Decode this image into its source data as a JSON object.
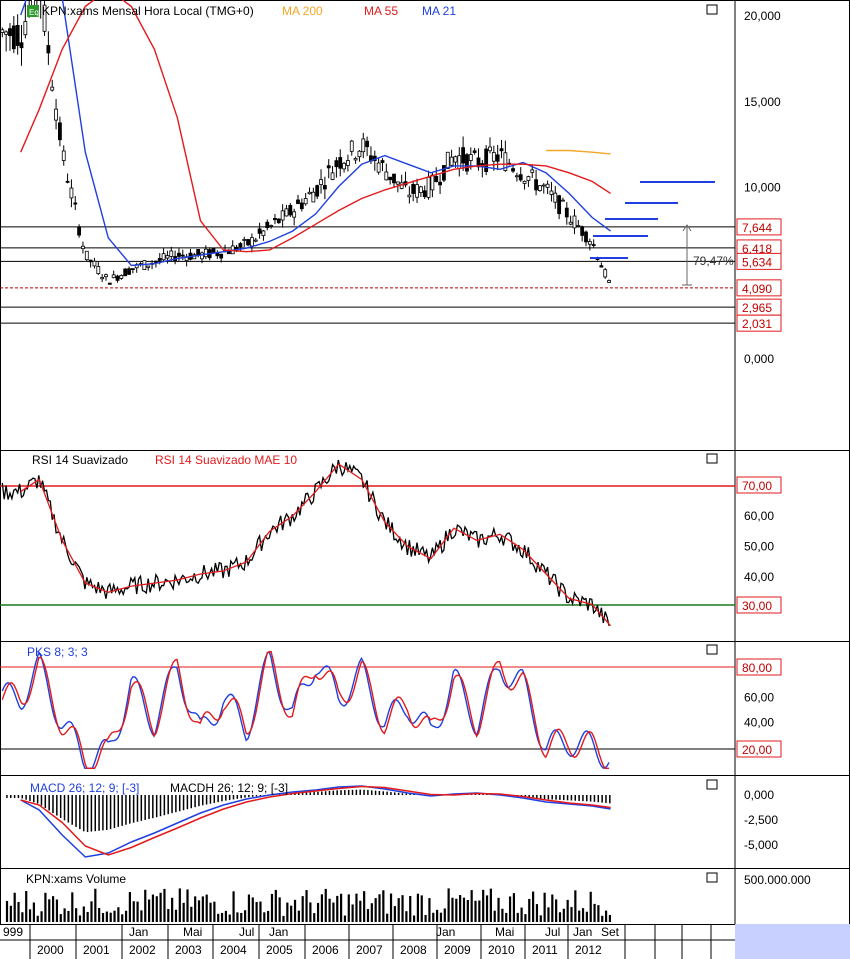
{
  "colors": {
    "black": "#000000",
    "red": "#e31a1c",
    "blue": "#1f3fe0",
    "orange": "#f5a623",
    "green": "#1a7a1a",
    "grid": "#000000"
  },
  "main_panel": {
    "badge": "Eq",
    "title": "KPN:xams Mensal Hora Local (TMG+0)",
    "ma200_label": "MA 200",
    "ma55_label": "MA 55",
    "ma21_label": "MA 21",
    "y_ticks": [
      "20,000",
      "15,000",
      "10,000",
      "0,000"
    ],
    "level_labels": [
      "7,644",
      "6,418",
      "5,634",
      "4,090",
      "2,965",
      "2,031"
    ],
    "pct_label": "79,47%"
  },
  "rsi_panel": {
    "title": "RSI 14 Suavizado",
    "sub": "RSI 14 Suavizado MAE 10",
    "y_ticks": [
      "60,00",
      "50,00",
      "40,00"
    ],
    "hi_label": "70,00",
    "lo_label": "30,00"
  },
  "pks_panel": {
    "title": "PKS 8; 3; 3",
    "y_ticks": [
      "60,00",
      "40,00"
    ],
    "hi_label": "80,00",
    "lo_label": "20,00"
  },
  "macd_panel": {
    "title": "MACD 26; 12; 9; [-3]",
    "sub": "MACDH 26; 12; 9; [-3]",
    "y_ticks": [
      "0,000",
      "-2,500",
      "-5,000"
    ]
  },
  "vol_panel": {
    "title": "KPN:xams Volume",
    "y_ticks": [
      "500.000.000"
    ]
  },
  "x_axis": {
    "months": [
      "999",
      "Jan",
      "Mai",
      "Jul",
      "Jan",
      "Jan",
      "Jan",
      "Mai",
      "Jul",
      "Jan",
      "Set"
    ],
    "years": [
      "2000",
      "2001",
      "2002",
      "2003",
      "2004",
      "2005",
      "2006",
      "2007",
      "2008",
      "2009",
      "2010",
      "2011",
      "2012"
    ]
  },
  "chart_data": {
    "type": "line",
    "title": "KPN:xams Mensal Hora Local (TMG+0)",
    "x": [
      1999.9,
      2000.3,
      2000.8,
      2001.3,
      2001.8,
      2002.3,
      2002.8,
      2003.3,
      2003.8,
      2004.3,
      2004.8,
      2005.3,
      2005.8,
      2006.3,
      2006.8,
      2007.3,
      2007.8,
      2008.3,
      2008.8,
      2009.3,
      2009.8,
      2010.3,
      2010.8,
      2011.3,
      2011.8,
      2012.3,
      2012.7
    ],
    "series": [
      {
        "name": "KPN:xams",
        "values": [
          19,
          22,
          12,
          6,
          4.5,
          5.2,
          5.6,
          6.0,
          6.0,
          6.2,
          6.6,
          7.6,
          8.6,
          9.8,
          11.5,
          12.4,
          11.0,
          9.6,
          10.0,
          11.8,
          11.4,
          11.8,
          10.8,
          9.8,
          8.3,
          6.8,
          4.1
        ]
      },
      {
        "name": "MA 21",
        "values": [
          20,
          23,
          21,
          12,
          7,
          5.4,
          5.5,
          5.8,
          6.0,
          6.2,
          6.4,
          6.8,
          7.4,
          8.4,
          10,
          11.3,
          11.8,
          11.3,
          10.8,
          11.2,
          11.2,
          11.0,
          11.4,
          10.8,
          9.6,
          8.2,
          7.4
        ]
      },
      {
        "name": "MA 55",
        "values": [
          12,
          14.5,
          18,
          20.5,
          21.5,
          20.5,
          18,
          14,
          8,
          6.3,
          6.2,
          6.3,
          7.0,
          7.8,
          8.6,
          9.3,
          9.8,
          10.2,
          10.6,
          11.0,
          11.2,
          11.3,
          11.3,
          11.2,
          10.8,
          10.3,
          9.6
        ]
      },
      {
        "name": "MA 200",
        "values": [
          null,
          null,
          null,
          null,
          null,
          null,
          null,
          null,
          null,
          null,
          null,
          null,
          null,
          null,
          null,
          null,
          null,
          null,
          null,
          null,
          null,
          null,
          null,
          12.1,
          12.1,
          12.0,
          11.9
        ]
      }
    ],
    "levels": [
      7.644,
      6.418,
      5.634,
      4.09,
      2.965,
      2.031
    ],
    "ylim": [
      0,
      21
    ],
    "rsi": {
      "ylim": [
        20,
        80
      ],
      "values": [
        68,
        72,
        52,
        38,
        35,
        37,
        38,
        39,
        41,
        42,
        45,
        55,
        60,
        68,
        77,
        72,
        58,
        50,
        46,
        56,
        52,
        54,
        49,
        41,
        33,
        31,
        24
      ]
    },
    "pks": {
      "ylim": [
        0,
        100
      ],
      "values": [
        60,
        85,
        40,
        10,
        15,
        70,
        40,
        85,
        30,
        60,
        35,
        90,
        45,
        90,
        60,
        80,
        40,
        55,
        30,
        75,
        40,
        85,
        70,
        20,
        25,
        20,
        12
      ]
    },
    "macd": {
      "ylim": [
        -6.5,
        1
      ],
      "values": [
        -0.5,
        -1.5,
        -4,
        -6.2,
        -5.8,
        -4.7,
        -3.8,
        -2.8,
        -1.8,
        -1,
        -0.4,
        0,
        0.3,
        0.5,
        0.8,
        0.9,
        0.6,
        0.2,
        -0.1,
        0.1,
        0.2,
        0,
        -0.3,
        -0.7,
        -0.9,
        -1.1,
        -1.4
      ]
    }
  }
}
